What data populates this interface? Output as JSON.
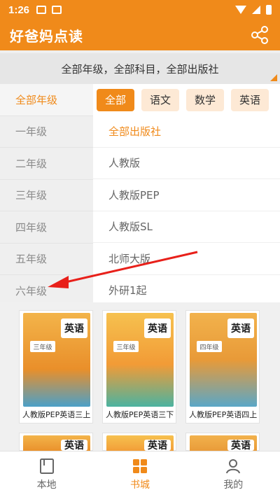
{
  "status": {
    "time": "1:26"
  },
  "header": {
    "title": "好爸妈点读"
  },
  "filter": {
    "summary": "全部年级，全部科目，全部出版社"
  },
  "grades": [
    {
      "label": "全部年级",
      "active": true
    },
    {
      "label": "一年级",
      "active": false
    },
    {
      "label": "二年级",
      "active": false
    },
    {
      "label": "三年级",
      "active": false
    },
    {
      "label": "四年级",
      "active": false
    },
    {
      "label": "五年级",
      "active": false
    },
    {
      "label": "六年级",
      "active": false
    }
  ],
  "subjects": [
    {
      "label": "全部",
      "active": true
    },
    {
      "label": "语文",
      "active": false
    },
    {
      "label": "数学",
      "active": false
    },
    {
      "label": "英语",
      "active": false
    }
  ],
  "publishers": [
    {
      "label": "全部出版社",
      "active": true
    },
    {
      "label": "人教版",
      "active": false
    },
    {
      "label": "人教版PEP",
      "active": false
    },
    {
      "label": "人教版SL",
      "active": false
    },
    {
      "label": "北师大版",
      "active": false
    },
    {
      "label": "外研1起",
      "active": false
    }
  ],
  "books": [
    {
      "title": "人教版PEP英语三上",
      "cover_title": "英语",
      "cover_grade": "三年级",
      "color": "#f0a43a"
    },
    {
      "title": "人教版PEP英语三下",
      "cover_title": "英语",
      "cover_grade": "三年级",
      "color": "#f7b13d"
    },
    {
      "title": "人教版PEP英语四上",
      "cover_title": "英语",
      "cover_grade": "四年级",
      "color": "#f6a23b"
    },
    {
      "title": "",
      "cover_title": "英语",
      "cover_grade": "",
      "color": "#f0a43a"
    },
    {
      "title": "",
      "cover_title": "英语",
      "cover_grade": "",
      "color": "#f0a43a"
    },
    {
      "title": "",
      "cover_title": "英语",
      "cover_grade": "",
      "color": "#f0a43a"
    }
  ],
  "tabs": [
    {
      "label": "本地",
      "icon": "book-icon",
      "active": false
    },
    {
      "label": "书城",
      "icon": "store-icon",
      "active": true
    },
    {
      "label": "我的",
      "icon": "person-icon",
      "active": false
    }
  ],
  "colors": {
    "accent": "#f08a1a",
    "accent_light": "#fde9d5",
    "arrow": "#e8201a"
  }
}
